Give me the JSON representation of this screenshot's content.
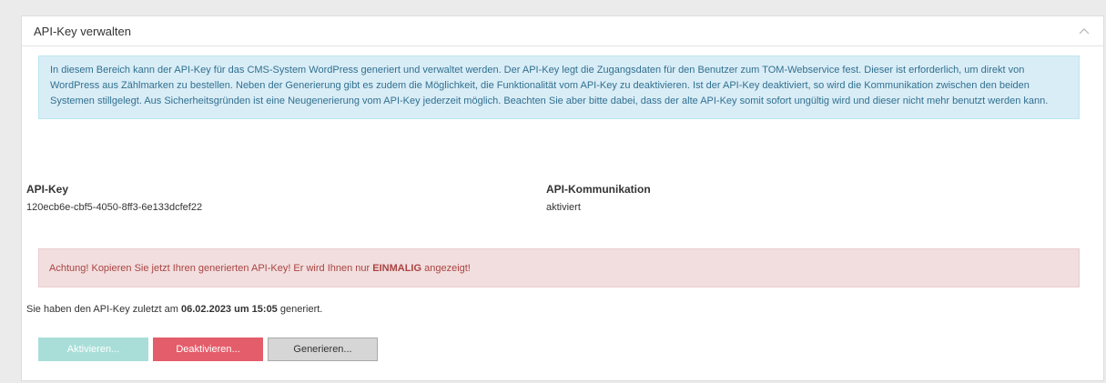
{
  "panel": {
    "title": "API-Key verwalten",
    "collapse_icon": "chevron-up-icon"
  },
  "info": {
    "text": "In diesem Bereich kann der API-Key für das CMS-System WordPress generiert und verwaltet werden. Der API-Key legt die Zugangsdaten für den Benutzer zum TOM-Webservice fest. Dieser ist erforderlich, um direkt von WordPress aus Zählmarken zu bestellen. Neben der Generierung gibt es zudem die Möglichkeit, die Funktionalität vom API-Key zu deaktivieren. Ist der API-Key deaktiviert, so wird die Kommunikation zwischen den beiden Systemen stillgelegt. Aus Sicherheitsgründen ist eine Neugenerierung vom API-Key jederzeit möglich. Beachten Sie aber bitte dabei, dass der alte API-Key somit sofort ungültig wird und dieser nicht mehr benutzt werden kann."
  },
  "api_key": {
    "label": "API-Key",
    "value": "120ecb6e-cbf5-4050-8ff3-6e133dcfef22"
  },
  "api_communication": {
    "label": "API-Kommunikation",
    "value": "aktiviert"
  },
  "alert": {
    "prefix": "Achtung! Kopieren Sie jetzt Ihren generierten API-Key! Er wird Ihnen nur ",
    "emphasis": "EINMALIG",
    "suffix": " angezeigt!"
  },
  "last_generated": {
    "prefix": "Sie haben den API-Key zuletzt am ",
    "datetime": "06.02.2023 um 15:05",
    "suffix": " generiert."
  },
  "buttons": {
    "activate": "Aktivieren...",
    "deactivate": "Deaktivieren...",
    "generate": "Generieren..."
  },
  "colors": {
    "info_background": "#d9edf7",
    "info_text": "#31708f",
    "alert_background": "#f2dede",
    "alert_text": "#a94442",
    "activate_button": "#a9ded8",
    "deactivate_button": "#e35d6a",
    "generate_button": "#d6d6d6"
  }
}
